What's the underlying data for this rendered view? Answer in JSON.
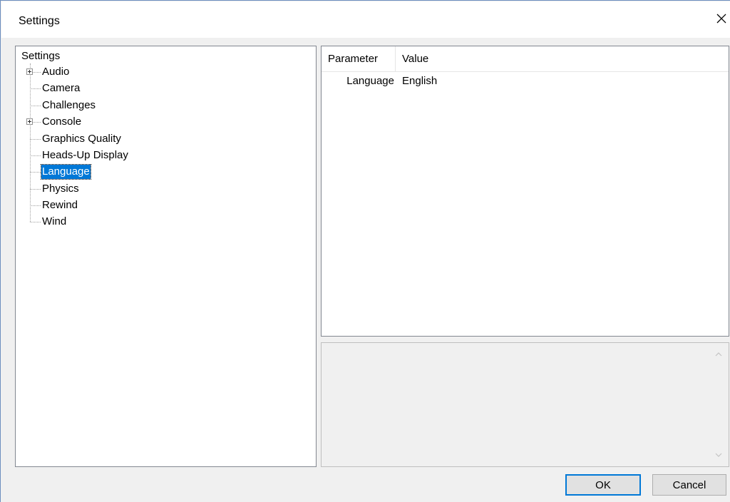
{
  "window": {
    "title": "Settings"
  },
  "tree": {
    "root_label": "Settings",
    "items": [
      {
        "label": "Audio",
        "expandable": true,
        "selected": false
      },
      {
        "label": "Camera",
        "expandable": false,
        "selected": false
      },
      {
        "label": "Challenges",
        "expandable": false,
        "selected": false
      },
      {
        "label": "Console",
        "expandable": true,
        "selected": false
      },
      {
        "label": "Graphics Quality",
        "expandable": false,
        "selected": false
      },
      {
        "label": "Heads-Up Display",
        "expandable": false,
        "selected": false
      },
      {
        "label": "Language",
        "expandable": false,
        "selected": true
      },
      {
        "label": "Physics",
        "expandable": false,
        "selected": false
      },
      {
        "label": "Rewind",
        "expandable": false,
        "selected": false
      },
      {
        "label": "Wind",
        "expandable": false,
        "selected": false
      }
    ]
  },
  "grid": {
    "headers": {
      "parameter": "Parameter",
      "value": "Value"
    },
    "rows": [
      {
        "parameter": "Language",
        "value": "English"
      }
    ]
  },
  "buttons": {
    "ok": "OK",
    "cancel": "Cancel"
  },
  "colors": {
    "selection": "#0078d7",
    "window_bg": "#f0f0f0"
  }
}
